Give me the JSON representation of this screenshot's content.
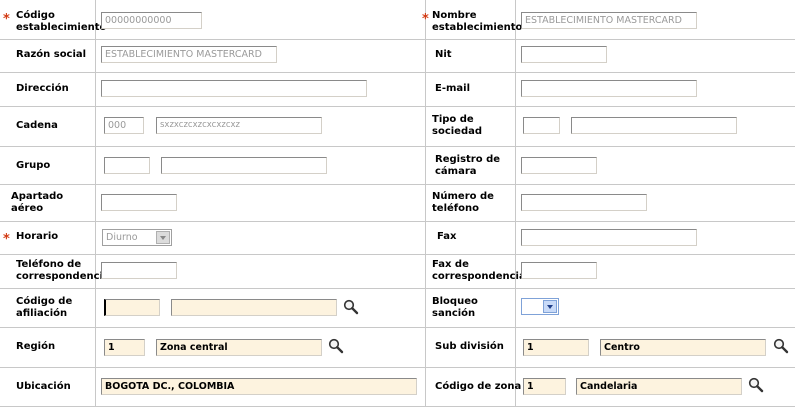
{
  "fields": {
    "codigo_establecimiento": {
      "label": "Código establecimiento",
      "value": "00000000000"
    },
    "nombre_establecimiento": {
      "label": "Nombre establecimiento",
      "value": "ESTABLECIMIENTO MASTERCARD"
    },
    "razon_social": {
      "label": "Razón social",
      "value": "ESTABLECIMIENTO MASTERCARD"
    },
    "nit": {
      "label": "Nit",
      "value": ""
    },
    "direccion": {
      "label": "Dirección",
      "value": ""
    },
    "email": {
      "label": "E-mail",
      "value": ""
    },
    "cadena": {
      "label": "Cadena",
      "code": "000",
      "value": "sxzxczcxzcxcxzcxz"
    },
    "tipo_sociedad": {
      "label": "Tipo de sociedad",
      "code": "",
      "value": ""
    },
    "grupo": {
      "label": "Grupo",
      "code": "",
      "value": ""
    },
    "registro_camara": {
      "label": "Registro de cámara",
      "value": ""
    },
    "apartado_aereo": {
      "label": "Apartado aéreo",
      "value": ""
    },
    "numero_telefono": {
      "label": "Número de teléfono",
      "value": ""
    },
    "horario": {
      "label": "Horario",
      "value": "Diurno"
    },
    "fax": {
      "label": "Fax",
      "value": ""
    },
    "telefono_correspondencia": {
      "label": "Teléfono de correspondencia",
      "value": ""
    },
    "fax_correspondencia": {
      "label": "Fax de correspondencia",
      "value": ""
    },
    "codigo_afiliacion": {
      "label": "Código de afiliación",
      "code": "",
      "value": ""
    },
    "bloqueo_sancion": {
      "label": "Bloqueo sanción",
      "value": ""
    },
    "region": {
      "label": "Región",
      "code": "1",
      "value": "Zona central"
    },
    "sub_division": {
      "label": "Sub división",
      "code": "1",
      "value": "Centro"
    },
    "ubicacion": {
      "label": "Ubicación",
      "value": "BOGOTA DC., COLOMBIA"
    },
    "codigo_zona": {
      "label": "Código de zona",
      "code": "1",
      "value": "Candelaria"
    }
  },
  "required_marker": "*",
  "icons": {
    "lookup": "magnifier-icon",
    "dropdown": "chevron-down-icon"
  },
  "colors": {
    "required": "#d23a12",
    "editable_bg": "#fdf3df",
    "readonly_text": "#9a9a9a",
    "separator": "#c8c8c8"
  }
}
